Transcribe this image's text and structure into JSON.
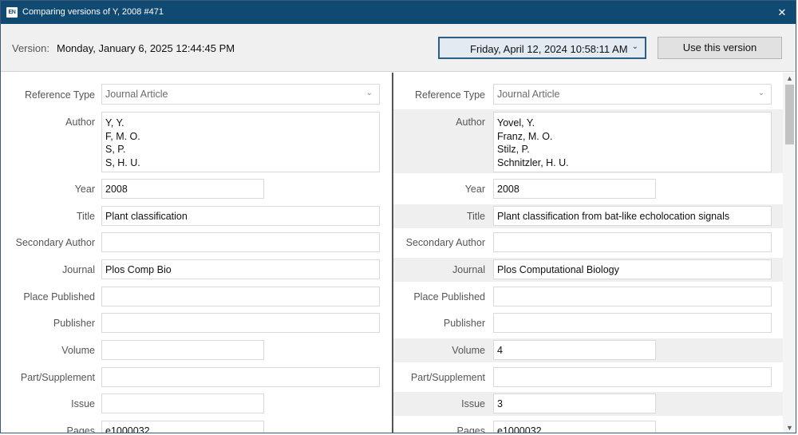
{
  "titlebar": {
    "app_icon_text": "EN",
    "title": "Comparing versions of Y, 2008 #471",
    "close_glyph": "✕"
  },
  "version_bar": {
    "label": "Version:",
    "current_version": "Monday, January 6, 2025 12:44:45 PM",
    "selected_version": "Friday, April 12, 2024 10:58:11 AM",
    "use_button": "Use this version"
  },
  "fields": {
    "reference_type": "Reference Type",
    "author": "Author",
    "year": "Year",
    "title": "Title",
    "secondary_author": "Secondary Author",
    "journal": "Journal",
    "place_published": "Place Published",
    "publisher": "Publisher",
    "volume": "Volume",
    "part_supplement": "Part/Supplement",
    "issue": "Issue",
    "pages": "Pages"
  },
  "left": {
    "reference_type": "Journal Article",
    "authors": [
      "Y, Y.",
      "F, M. O.",
      "S, P.",
      "S, H. U."
    ],
    "year": "2008",
    "title": "Plant classification",
    "secondary_author": "",
    "journal": "Plos Comp Bio",
    "place_published": "",
    "publisher": "",
    "volume": "",
    "part_supplement": "",
    "issue": "",
    "pages": "e1000032"
  },
  "right": {
    "reference_type": "Journal Article",
    "authors": [
      "Yovel, Y.",
      "Franz, M. O.",
      "Stilz, P.",
      "Schnitzler, H. U."
    ],
    "year": "2008",
    "title": "Plant classification from bat-like echolocation signals",
    "secondary_author": "",
    "journal": "Plos Computational Biology",
    "place_published": "",
    "publisher": "",
    "volume": "4",
    "part_supplement": "",
    "issue": "3",
    "pages": "e1000032"
  },
  "icons": {
    "dropdown": "chevron-down-icon",
    "close": "close-icon",
    "scroll_up": "scroll-up-icon",
    "scroll_down": "scroll-down-icon"
  },
  "colors": {
    "titlebar": "#104a72",
    "diff_row": "#efefef",
    "select_border": "#2d5e86"
  }
}
